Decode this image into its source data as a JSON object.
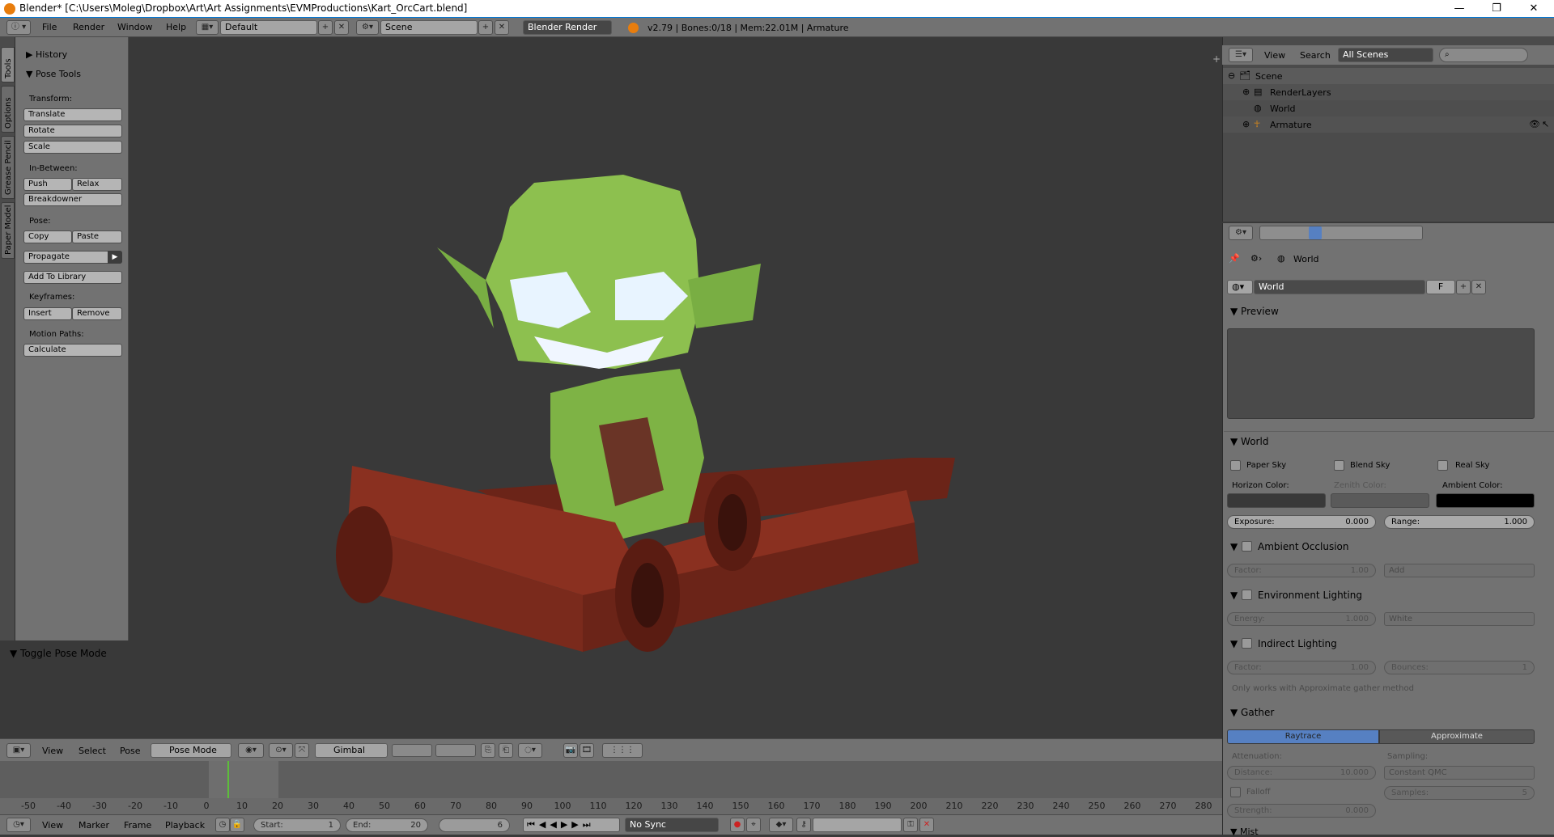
{
  "window": {
    "title": "Blender* [C:\\Users\\Moleg\\Dropbox\\Art\\Art Assignments\\EVMProductions\\Kart_OrcCart.blend]",
    "min": "—",
    "max": "❐",
    "close": "✕"
  },
  "topbar": {
    "menus": [
      "File",
      "Render",
      "Window",
      "Help"
    ],
    "layout": "Default",
    "scene": "Scene",
    "engine": "Blender Render",
    "stats": "v2.79 | Bones:0/18 | Mem:22.01M | Armature"
  },
  "vtabs": [
    "Tools",
    "Options",
    "Grease Pencil",
    "Paper Model"
  ],
  "toolshelf": {
    "history": "History",
    "pose_tools": "Pose Tools",
    "transform_label": "Transform:",
    "translate": "Translate",
    "rotate": "Rotate",
    "scale": "Scale",
    "inbetween_label": "In-Between:",
    "push": "Push",
    "relax": "Relax",
    "breakdowner": "Breakdowner",
    "pose_label": "Pose:",
    "copy": "Copy",
    "paste": "Paste",
    "propagate": "Propagate",
    "add_to_library": "Add To Library",
    "keyframes_label": "Keyframes:",
    "insert": "Insert",
    "remove": "Remove",
    "motion_label": "Motion Paths:",
    "calculate": "Calculate",
    "toggle_pose": "Toggle Pose Mode"
  },
  "viewport_header": {
    "menus": [
      "View",
      "Select",
      "Pose"
    ],
    "mode": "Pose Mode",
    "orientation": "Gimbal"
  },
  "timeline": {
    "ticks": [
      -50,
      -40,
      -30,
      -20,
      -10,
      0,
      10,
      20,
      30,
      40,
      50,
      60,
      70,
      80,
      90,
      100,
      110,
      120,
      130,
      140,
      150,
      160,
      170,
      180,
      190,
      200,
      210,
      220,
      230,
      240,
      250,
      260,
      270,
      280
    ],
    "current_frame": 6,
    "menus": [
      "View",
      "Marker",
      "Frame",
      "Playback"
    ],
    "start_label": "Start:",
    "start": "1",
    "end_label": "End:",
    "end": "20",
    "frame": "6",
    "sync": "No Sync"
  },
  "outliner": {
    "menus": [
      "View",
      "Search"
    ],
    "filter": "All Scenes",
    "items": [
      "Scene",
      "RenderLayers",
      "World",
      "Armature"
    ]
  },
  "properties": {
    "context": "World",
    "world_name": "World",
    "fake_user": "F",
    "preview": "Preview",
    "world_section": "World",
    "paper_sky": "Paper Sky",
    "blend_sky": "Blend Sky",
    "real_sky": "Real Sky",
    "horizon_label": "Horizon Color:",
    "zenith_label": "Zenith Color:",
    "ambient_label": "Ambient Color:",
    "exposure_label": "Exposure:",
    "exposure": "0.000",
    "range_label": "Range:",
    "range": "1.000",
    "ao": "Ambient Occlusion",
    "ao_factor_label": "Factor:",
    "ao_factor": "1.00",
    "ao_blend": "Add",
    "env": "Environment Lighting",
    "energy_label": "Energy:",
    "energy": "1.000",
    "env_color": "White",
    "indirect": "Indirect Lighting",
    "ind_factor_label": "Factor:",
    "ind_factor": "1.00",
    "bounces_label": "Bounces:",
    "bounces": "1",
    "indirect_note": "Only works with Approximate gather method",
    "gather": "Gather",
    "raytrace": "Raytrace",
    "approximate": "Approximate",
    "attenuation_label": "Attenuation:",
    "sampling_label": "Sampling:",
    "distance_label": "Distance:",
    "distance": "10.000",
    "sampling": "Constant QMC",
    "falloff": "Falloff",
    "samples_label": "Samples:",
    "samples": "5",
    "strength_label": "Strength:",
    "strength": "0.000",
    "mist": "Mist"
  },
  "colors": {
    "accent_blue": "#5680c2",
    "viewport_bg": "#393939",
    "orc_green": "#8dc04f",
    "cart_brown": "#7a2a1c"
  }
}
